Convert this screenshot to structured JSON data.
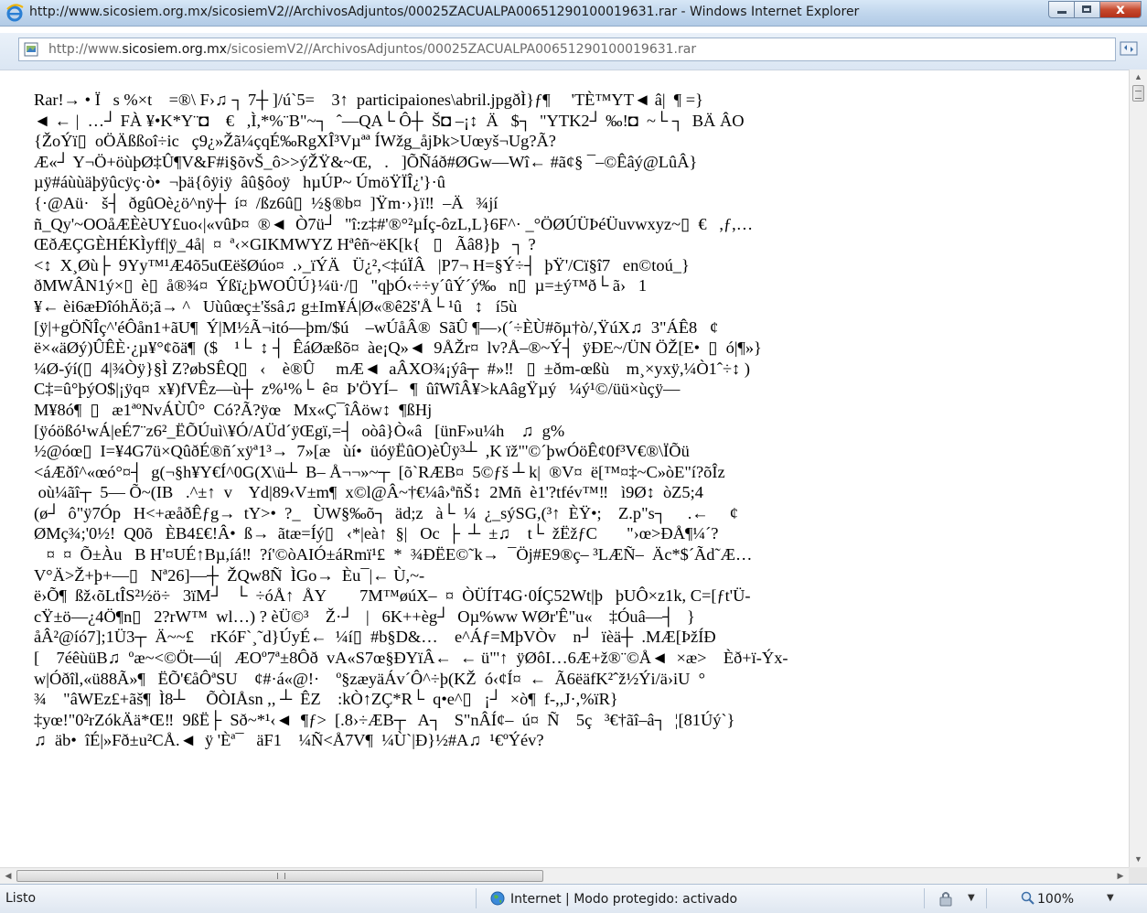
{
  "window": {
    "title": "http://www.sicosiem.org.mx/sicosiemV2//ArchivosAdjuntos/00025ZACUALPA00651290100019631.rar - Windows Internet Explorer",
    "close_glyph": "x"
  },
  "address_bar": {
    "url_prefix": "http://www.",
    "url_domain": "sicosiem.org.mx",
    "url_path": "/sicosiemV2//ArchivosAdjuntos/00025ZACUALPA00651290100019631.rar"
  },
  "content": {
    "raw_text": "Rar!→ • Ï   s %×t    =®\\ F›♫ ┐ 7┼ ]/ú`5=    3↑  participaiones\\abril.jpgðÌ}ƒ¶     'TÈ™YT◄ â|  ¶ =}\n◄ ← |  …┘ FÀ ¥•K*Y¨◘    €   ,Ì,*%¨B\"~┐  ˆ—QA└ Ô┼  Š◘ –¡↕  Ä   $┐  \"YTK2┘ ‰!◘  ~└ ┐  BÄ ÂO\n{ŽoÝï▯  oÖÄßßoî÷ic   ç9¿»Žã¼çqÉ‰RgXÎ³Vµªª ÍWžg_åjÞk>Uœyš¬Ug?Ã?\nÆ«┘ Y¬Ö+öùþØ‡Û¶V&F#i§õvŠ_ô>>ýŽŸ&~Œ,   .   ]ÕÑáð#ØGw—Wî← #ã¢§ ¯–©Êâý@LûÂ}\nµÿ#áùùäþÿûcÿç·ò•  ¬þä{ôÿiÿ  âû§ôoÿ   hµÚP~ ÚmöŸÏÎ¿'}·û\n{·@Aü·   š┤  ðgûOè¿ö^nÿ┼  í¤  /ßz6û▯  ½§®b¤  ]Ÿm·›}ï‼  –Ä   ¾jí\nñ_Qy'~OOåÆÈèUY£uo‹|«vûÞ¤  ®◄  Ò7ü┘  \"î:z‡#'®°²µÍç-ôzL,L}6F^· _°ÖØÚÜÞéÜuvwxyz~▯  €   ,ƒ,…\nŒðÆÇGÈHÉKÌyff|ÿ_4å|  ¤  ª‹×GIKMWYZ Hªêñ~ëK[k{   ▯   Ãâ8}þ   ┐ ?\n<↕  X¸Øù├  9Yy™¹Æ4õ5uŒëšØúo¤  .›_ïÝÄ   Ü¿²,<‡úÏÂ   |P7¬ H=§Ý÷┤  þŸ'/Cï§î7   en©toú_}\nðMWÂN1ý×▯  è▯  å®¾¤  Ýßï¿þWOÛÚ}¼ü·/▯   \"qþÓ‹÷÷y´ûÝ´ý‰   n▯  µ=±ý™ð└ ã›   1\n¥← èi6æÐîóhÄö;ã→ ^   Uùûœç±'šsâ♫ g±Im¥Á|Ø«®ê2š'Å└ ¹û   ↕   í5ù\n[ÿ|+gÖÑÎç^'éÔån1+ãU¶  Ý|M½Ã¬itó—þm/$ú    –wÚåÂ®  SãÛ ¶—›(´÷ÈÙ#õµ†ò/,ŸúX♫  3\"ÁÊ8   ¢\në×«äØý)ÛÊÈ·¿µ¥°¢õä¶  ($    ¹└  ↕ ┤  ÊáØæßõ¤  àe¡Q»◄  9ÅŽr¤  lv?Å–®~Ý┤  ÿÐE~/ÜN ÖŽ[E•  ▯  ó|¶»}\n¼Ø-ýí(▯  4|¾Òÿ}§Ì Z?øbSÊQ▯   ‹    è®Û     mÆ◄  aÂXO¾¡ýâ┬  #»‼   ▯  ±ðm-œßù    m¸×yxÿ,¼Ò1ˆ÷↕ )\nC‡=û°þýO$|¡ÿq¤  x¥)fVÊz—ù┼  z%¹%└  ê¤  Þ'ÖYÍ–   ¶  ûîWîÂ¥>kAâgŸµý   ¼ý¹©/üü×ùçÿ—\nM¥8ó¶  ▯   æ1ªºNvÁÙÛ°  Có?Ã?ÿœ   Mx«Ç¯îÂöw↕  ¶ßHj\n[ÿóößó¹wÁ|eÉ7¨z6²_ËÕÚuì\\¥Ó/AÜd´ÿŒgï,=┤  oòâ}Ò«â   [ünF»u¼h    ♫  g%\n½@óœ▯  I=¥4G7ü×QûðÉ®ñ´xÿª1³→  7»[æ   ùí•  üóÿËûO)èÛÿ³┴  ,K ïž\"'©´þwÓöÊ¢0f³V€®\\ÏÕü\n<áÆðî^«œó°¤┤  g(¬§h¥Y€Í^0G(X\\ü┴  B– Å¬¬»~┬  [õ`RÆB¤  5©ƒš ┴ k|  ®V¤  ë[™¤‡~C»òE\"í?õÎz\n où¼ãî┬  5— Õ~(IB   .^±↑  v    Yd|89‹V±m¶  x©l@Â~†€¼â›ªñŠ↕  2Mñ  è1'?tfév™‼   ì9Ø↕  òZ5;4\n(ø┘  ô\"ÿ7Óp   H<+æåðÊƒg→  tY>•  ?_   ÙW§‰õ┐  äd;z   à└  ¼  ¿_sýSG,(³↑  ÈŸ•;    Z.p\"s┐     .←     ¢\nØMç¾;'0½!  Q0õ   ÈB4£€!Â•  ß→  ãtæ=Íý▯   ‹*|eà↑  §|   Oc  ├  ┴  ±♫    t└  žËžƒC       \"›œ>ÐÅ¶¼´?\n   ¤  ¤  Õ±Àu   B H'¤UÉ↑Bµ,íá‼  ?í'©òAIÓ±áRmï¹£  *  ¾ÐËE©˜k→  ¯Öj#E9®ç– ³LÆÑ–  Äc*$´Ãd˜Æ…\nV°Ä>Ž+þ+—▯   Nª26]—┼  ŽQw8Ñ  ÌGo→  Èu¯|← Ù,~-\në›Õ¶  ßž‹õLtÎS²½ö÷   3ïM┘   └  ÷óÅ↑  ÅY        7M™øúX–  ¤  ÒÜÍT4G·0ÍÇ52Wt|þ   þUÔ×z1k, C=[ƒt'Ü-\ncŸ±ö—¿4Ö¶n▯   2?rW™  wl…) ? èÜ©³    Ž·┘   |   6K++èg┘  Oµ%ww WØr'Ê\"u«    ‡Óuâ—┤   }\nåÂ²@íó7];1Ü3┬  Ä~~£    rKóF`¸˜d}ÚyÉ←  ¼í▯  #b§D&…    e^Áƒ=MþVÒv    n┘  ïèä┼  .MÆ[ÞžÍÐ\n[    7éêùüB♫  ºæ~<©Öt—ú|   ÆOº7ª±8Ôð  vA«S7œ§ÐYïÂ←  ← ü\"'↑  ÿØôI…6Æ+ž®¨©Å◄  ×æ>    Èð+ï-Ýx-\nw|Óðîl,«ü88Ã»¶   ËÕ'€åÔªSU    ¢#·á«@!·    º§zæyäÁv´Ô^÷þ(KŽ  ó‹¢Í¤  ←  Ã6ëäfK²ˆž½Ýi/ä›iU  °\n¾    \"âWEz£+ãš¶  Ì8┴     ÕÒIÅsn ,, ┴  ÊZ    :kÒ↑ZÇ*R└  q•e^▯   ¡┘  ×ò¶  f-,,J·,%ïR}\n‡yœ!\"0²rZókÄä*Œ‼  9ßË├  Sð~*¹‹◄  ¶ƒ>  [.8›÷ÆB┬   A┐   S\"nÂÍ¢–  ú¤  Ñ    5ç   ³€†ãî–â┐  ¦[81Úý`}\n♫  äb•  îÉ|»Fð±u²CÅ.◄  ÿ 'Èª¯   äF1    ¼Ñ<Å7V¶  ¼Ù`|Ð}½#A♫  ¹€ºÝév?"
  },
  "scrollbars": {
    "up_arrow": "▲",
    "down_arrow": "▼",
    "left_arrow": "◀",
    "right_arrow": "▶",
    "grip_glyph": "III"
  },
  "status_bar": {
    "status_text": "Listo",
    "zone_text": "Internet | Modo protegido: activado",
    "zoom_label": "100%",
    "security_dropdown_glyph": "▼",
    "zoom_dropdown_glyph": "▼"
  },
  "icons": {
    "browser": "internet-explorer-icon",
    "page": "page-icon",
    "compat": "compatibility-view-icon",
    "zone": "globe-icon",
    "security": "security-lock-icon",
    "zoom": "zoom-magnifier-icon"
  },
  "colors": {
    "titlebar": "#c9dcef",
    "close_button": "#c74a2e",
    "url_domain": "#111111",
    "url_dim": "#6b6b6b"
  }
}
